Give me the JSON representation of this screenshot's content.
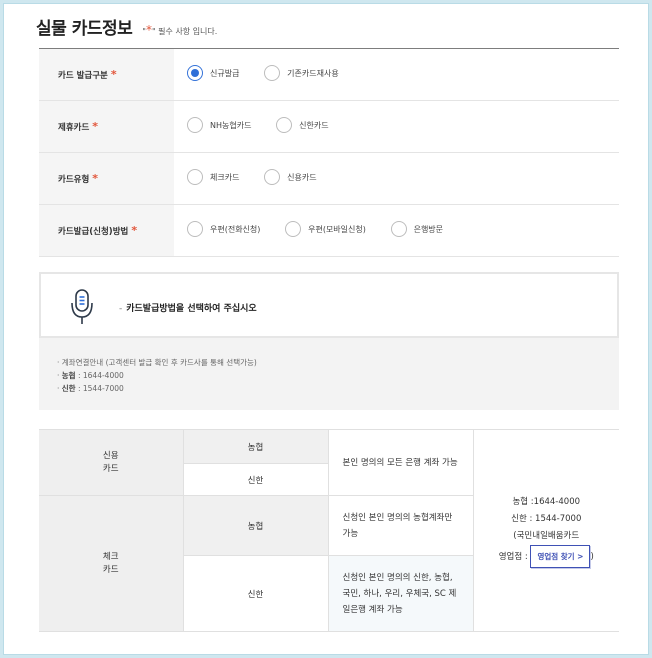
{
  "title": "실물 카드정보",
  "required_note": {
    "prefix": "\"",
    "star": "*",
    "suffix": "\" 필수 사항 입니다."
  },
  "rows": [
    {
      "label": "카드 발급구분",
      "options": [
        {
          "label": "신규발급",
          "selected": true
        },
        {
          "label": "기존카드재사용",
          "selected": false
        }
      ]
    },
    {
      "label": "제휴카드",
      "options": [
        {
          "label": "NH농협카드",
          "selected": false
        },
        {
          "label": "신한카드",
          "selected": false
        }
      ]
    },
    {
      "label": "카드유형",
      "options": [
        {
          "label": "체크카드",
          "selected": false
        },
        {
          "label": "신용카드",
          "selected": false
        }
      ]
    },
    {
      "label": "카드발급(신청)방법",
      "options": [
        {
          "label": "우편(전화신청)",
          "selected": false
        },
        {
          "label": "우편(모바일신청)",
          "selected": false
        },
        {
          "label": "은행방문",
          "selected": false
        }
      ]
    }
  ],
  "star": "*",
  "guide": {
    "dash": "-",
    "message": "카드발급방법을 선택하여 주십시오",
    "info": [
      {
        "bullet": "·",
        "label": "",
        "text": "계좌연결안내 (고객센터 발급 확인 후 카드사를 통해 선택가능)"
      },
      {
        "bullet": "·",
        "label": "농협",
        "text": " : 1644-4000"
      },
      {
        "bullet": "·",
        "label": "신한",
        "text": " : 1544-7000"
      }
    ]
  },
  "phone_table": {
    "credit_line1": "신용",
    "credit_line2": "카드",
    "check_line1": "체크",
    "check_line2": "카드",
    "nh": "농협",
    "shinhan": "신한",
    "desc_credit": "본인 명의의 모든 은행 계좌 가능",
    "desc_check_nh": "신청인 본인 명의의 농협계좌만 가능",
    "desc_check_shinhan": "신청인 본인 명의의 신한, 농협, 국민, 하나, 우리, 우체국, SC 제일은행 계좌 가능",
    "contact_nh": "농협 :1644-4000",
    "contact_shinhan": "신한 : 1544-7000",
    "contact_kb": "(국민내일배움카드",
    "branch_label": "영업점 :",
    "branch_button": "영업점 찾기 >",
    "branch_close": ")"
  },
  "colors": {
    "accent": "#2f6fd8",
    "required": "#e2563b",
    "button": "#3f51b5"
  }
}
